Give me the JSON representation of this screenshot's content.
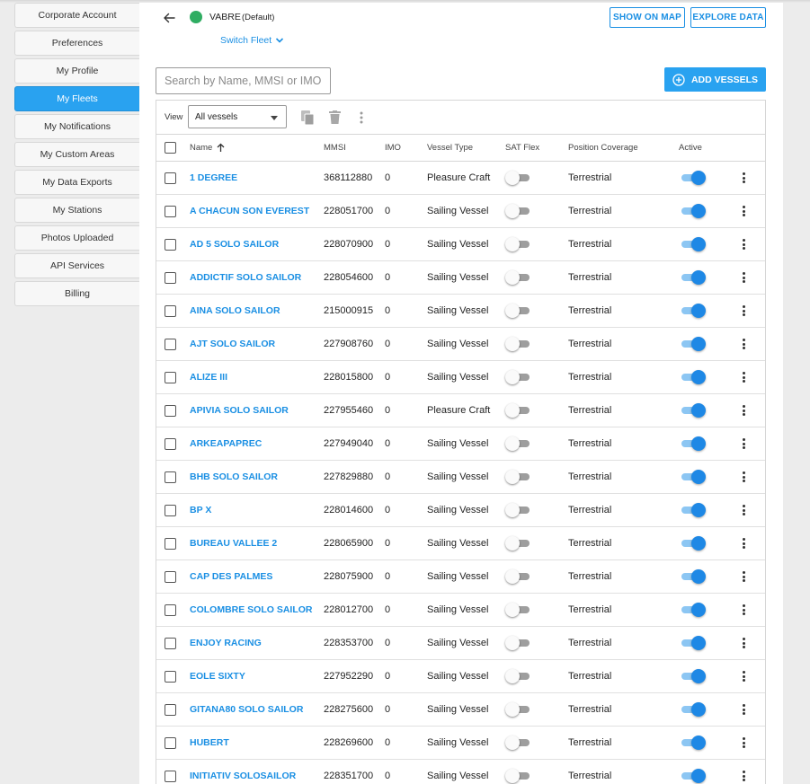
{
  "sidebar": {
    "items": [
      {
        "label": "Corporate Account",
        "active": false
      },
      {
        "label": "Preferences",
        "active": false
      },
      {
        "label": "My Profile",
        "active": false
      },
      {
        "label": "My Fleets",
        "active": true
      },
      {
        "label": "My Notifications",
        "active": false
      },
      {
        "label": "My Custom Areas",
        "active": false
      },
      {
        "label": "My Data Exports",
        "active": false
      },
      {
        "label": "My Stations",
        "active": false
      },
      {
        "label": "Photos Uploaded",
        "active": false
      },
      {
        "label": "API Services",
        "active": false
      },
      {
        "label": "Billing",
        "active": false
      }
    ]
  },
  "header": {
    "fleet_name": "VABRE",
    "fleet_default": "(Default)",
    "fleet_status_color": "#2fad62",
    "switch_fleet": "Switch Fleet",
    "show_on_map": "SHOW ON MAP",
    "explore_data": "EXPLORE DATA"
  },
  "search": {
    "placeholder": "Search by Name, MMSI or IMO",
    "value": ""
  },
  "add_vessels": "ADD VESSELS",
  "toolbar": {
    "view_label": "View",
    "view_value": "All vessels"
  },
  "columns": {
    "name": "Name",
    "mmsi": "MMSI",
    "imo": "IMO",
    "vessel_type": "Vessel Type",
    "sat_flex": "SAT Flex",
    "position_coverage": "Position Coverage",
    "active": "Active"
  },
  "colors": {
    "accent": "#29a2f0",
    "link": "#1a8fe3",
    "toggle_on": "#1e88e5"
  },
  "rows": [
    {
      "name": "1 DEGREE",
      "mmsi": "368112880",
      "imo": "0",
      "type": "Pleasure Craft",
      "sat_flex": false,
      "coverage": "Terrestrial",
      "active": true
    },
    {
      "name": "A CHACUN SON EVEREST",
      "mmsi": "228051700",
      "imo": "0",
      "type": "Sailing Vessel",
      "sat_flex": false,
      "coverage": "Terrestrial",
      "active": true
    },
    {
      "name": "AD 5 SOLO SAILOR",
      "mmsi": "228070900",
      "imo": "0",
      "type": "Sailing Vessel",
      "sat_flex": false,
      "coverage": "Terrestrial",
      "active": true
    },
    {
      "name": "ADDICTIF SOLO SAILOR",
      "mmsi": "228054600",
      "imo": "0",
      "type": "Sailing Vessel",
      "sat_flex": false,
      "coverage": "Terrestrial",
      "active": true
    },
    {
      "name": "AINA SOLO SAILOR",
      "mmsi": "215000915",
      "imo": "0",
      "type": "Sailing Vessel",
      "sat_flex": false,
      "coverage": "Terrestrial",
      "active": true
    },
    {
      "name": "AJT SOLO SAILOR",
      "mmsi": "227908760",
      "imo": "0",
      "type": "Sailing Vessel",
      "sat_flex": false,
      "coverage": "Terrestrial",
      "active": true
    },
    {
      "name": "ALIZE III",
      "mmsi": "228015800",
      "imo": "0",
      "type": "Sailing Vessel",
      "sat_flex": false,
      "coverage": "Terrestrial",
      "active": true
    },
    {
      "name": "APIVIA SOLO SAILOR",
      "mmsi": "227955460",
      "imo": "0",
      "type": "Pleasure Craft",
      "sat_flex": false,
      "coverage": "Terrestrial",
      "active": true
    },
    {
      "name": "ARKEAPAPREC",
      "mmsi": "227949040",
      "imo": "0",
      "type": "Sailing Vessel",
      "sat_flex": false,
      "coverage": "Terrestrial",
      "active": true
    },
    {
      "name": "BHB SOLO SAILOR",
      "mmsi": "227829880",
      "imo": "0",
      "type": "Sailing Vessel",
      "sat_flex": false,
      "coverage": "Terrestrial",
      "active": true
    },
    {
      "name": "BP X",
      "mmsi": "228014600",
      "imo": "0",
      "type": "Sailing Vessel",
      "sat_flex": false,
      "coverage": "Terrestrial",
      "active": true
    },
    {
      "name": "BUREAU VALLEE 2",
      "mmsi": "228065900",
      "imo": "0",
      "type": "Sailing Vessel",
      "sat_flex": false,
      "coverage": "Terrestrial",
      "active": true
    },
    {
      "name": "CAP DES PALMES",
      "mmsi": "228075900",
      "imo": "0",
      "type": "Sailing Vessel",
      "sat_flex": false,
      "coverage": "Terrestrial",
      "active": true
    },
    {
      "name": "COLOMBRE SOLO SAILOR",
      "mmsi": "228012700",
      "imo": "0",
      "type": "Sailing Vessel",
      "sat_flex": false,
      "coverage": "Terrestrial",
      "active": true
    },
    {
      "name": "ENJOY RACING",
      "mmsi": "228353700",
      "imo": "0",
      "type": "Sailing Vessel",
      "sat_flex": false,
      "coverage": "Terrestrial",
      "active": true
    },
    {
      "name": "EOLE SIXTY",
      "mmsi": "227952290",
      "imo": "0",
      "type": "Sailing Vessel",
      "sat_flex": false,
      "coverage": "Terrestrial",
      "active": true
    },
    {
      "name": "GITANA80 SOLO SAILOR",
      "mmsi": "228275600",
      "imo": "0",
      "type": "Sailing Vessel",
      "sat_flex": false,
      "coverage": "Terrestrial",
      "active": true
    },
    {
      "name": "HUBERT",
      "mmsi": "228269600",
      "imo": "0",
      "type": "Sailing Vessel",
      "sat_flex": false,
      "coverage": "Terrestrial",
      "active": true
    },
    {
      "name": "INITIATIV SOLOSAILOR",
      "mmsi": "228351700",
      "imo": "0",
      "type": "Sailing Vessel",
      "sat_flex": false,
      "coverage": "Terrestrial",
      "active": true
    }
  ]
}
